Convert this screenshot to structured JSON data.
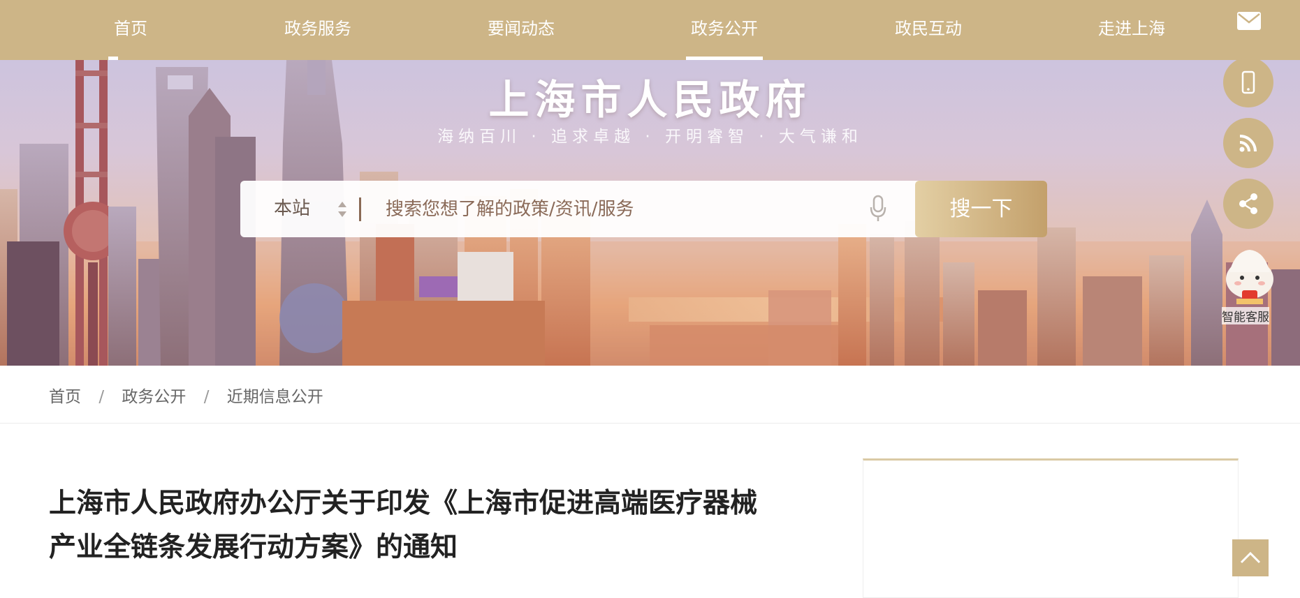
{
  "nav": {
    "items": [
      {
        "label": "首页",
        "active": true
      },
      {
        "label": "政务服务",
        "active": false
      },
      {
        "label": "要闻动态",
        "active": false
      },
      {
        "label": "政务公开",
        "active": true
      },
      {
        "label": "政民互动",
        "active": false
      },
      {
        "label": "走进上海",
        "active": false
      }
    ]
  },
  "hero": {
    "title": "上海市人民政府",
    "slogan": "海纳百川 · 追求卓越 · 开明睿智 · 大气谦和"
  },
  "search": {
    "scope": "本站",
    "placeholder": "搜索您想了解的政策/资讯/服务",
    "button": "搜一下"
  },
  "float": {
    "icons": [
      "mail-icon",
      "mobile-icon",
      "rss-icon",
      "share-icon"
    ],
    "assistant_label": "智能客服"
  },
  "breadcrumb": {
    "items": [
      "首页",
      "政务公开",
      "近期信息公开"
    ],
    "separator": "/"
  },
  "article": {
    "title_line1": "上海市人民政府办公厅关于印发《上海市促进高端医疗器械",
    "title_line2": "产业全链条发展行动方案》的通知"
  },
  "colors": {
    "brand": "#cdb587",
    "button_gradient_start": "#e3cfa4",
    "button_gradient_end": "#c3a06b",
    "title_text": "#222222"
  }
}
